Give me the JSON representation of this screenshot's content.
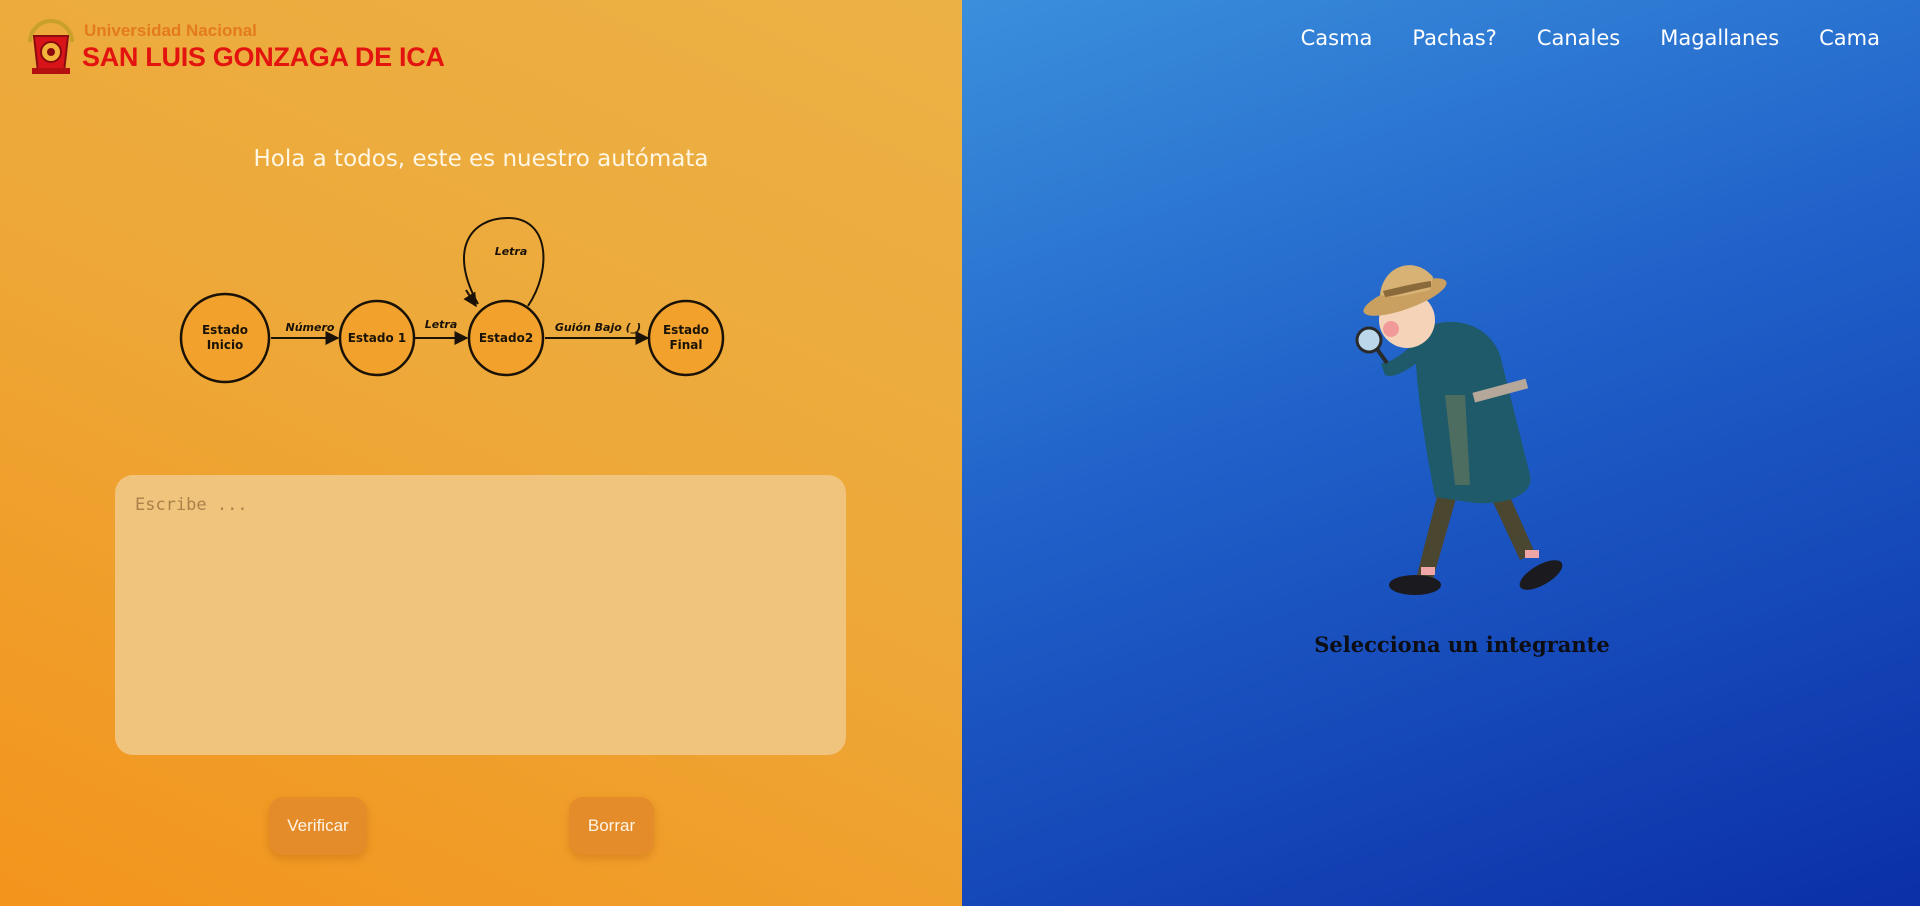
{
  "logo": {
    "small": "Universidad Nacional",
    "big": "SAN LUIS GONZAGA DE ICA"
  },
  "title": "Hola a todos, este es nuestro autómata",
  "diagram": {
    "states": [
      {
        "line1": "Estado",
        "line2": "Inicio"
      },
      {
        "line1": "Estado 1",
        "line2": ""
      },
      {
        "line1": "Estado2",
        "line2": ""
      },
      {
        "line1": "Estado",
        "line2": "Final"
      }
    ],
    "transitions": [
      "Número",
      "Letra",
      "Guión Bajo (_)",
      "Letra"
    ]
  },
  "input": {
    "placeholder": "Escribe ...",
    "value": ""
  },
  "buttons": {
    "verify": "Verificar",
    "clear": "Borrar"
  },
  "nav": {
    "items": [
      {
        "label": "Casma"
      },
      {
        "label": "Pachas?"
      },
      {
        "label": "Canales"
      },
      {
        "label": "Magallanes"
      },
      {
        "label": "Cama"
      }
    ]
  },
  "prompt": "Selecciona un integrante",
  "colors": {
    "left_panel": "#f0a030",
    "right_panel": "#1f5fc8",
    "input_bg": "#f1c47e",
    "button_bg": "#e58c2a",
    "logo_red": "#e3140f"
  }
}
